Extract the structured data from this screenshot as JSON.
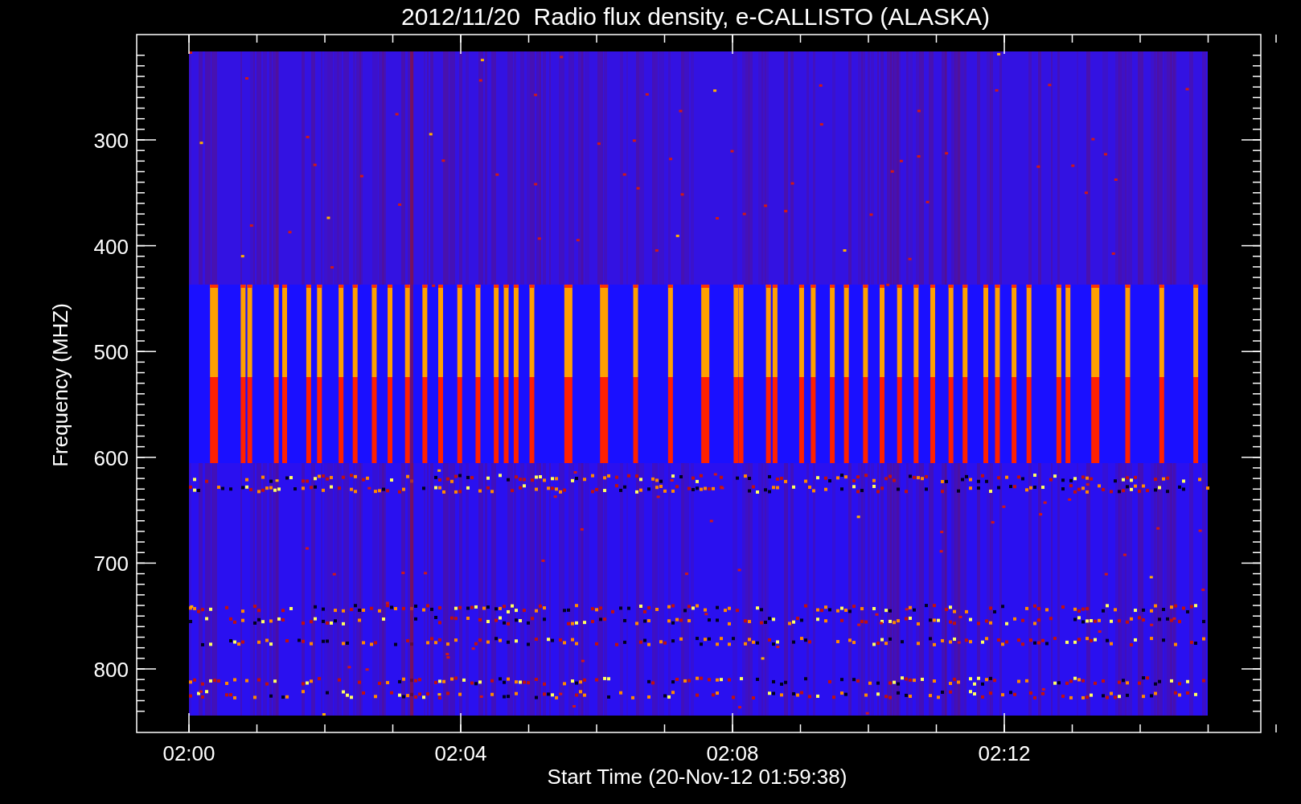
{
  "title": "2012/11/20  Radio flux density, e-CALLISTO (ALASKA)",
  "y_axis": {
    "label": "Frequency (MHZ)",
    "ticks": [
      "300",
      "400",
      "500",
      "600",
      "700",
      "800"
    ]
  },
  "x_axis": {
    "label": "Start Time (20-Nov-12 01:59:38)",
    "ticks": [
      "02:00",
      "02:04",
      "02:08",
      "02:12"
    ]
  }
}
